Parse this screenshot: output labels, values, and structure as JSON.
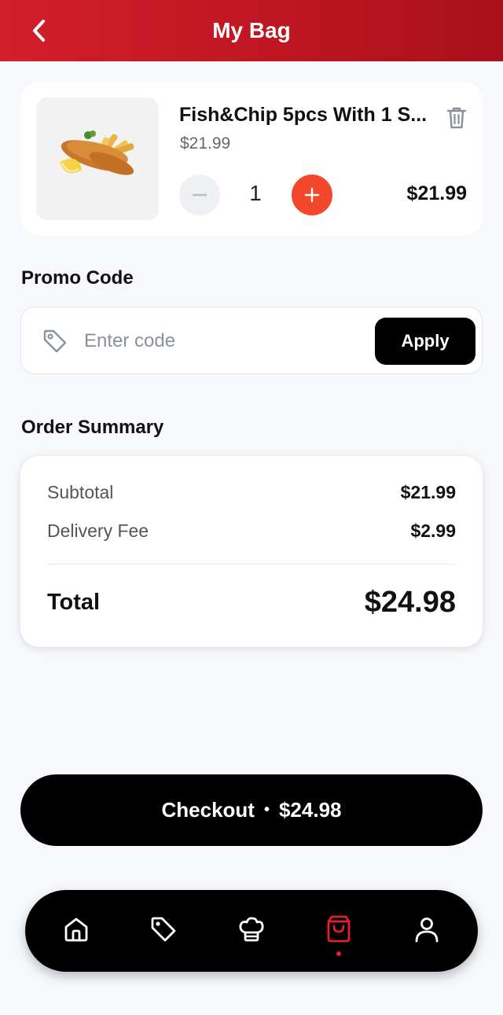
{
  "header": {
    "title": "My Bag",
    "back_icon": "chevron-left-icon"
  },
  "cart": {
    "items": [
      {
        "name": "Fish&Chip 5pcs With 1 S...",
        "unit_price": "$21.99",
        "quantity": "1",
        "line_total": "$21.99",
        "image": "fish-and-chips-photo"
      }
    ]
  },
  "promo": {
    "heading": "Promo Code",
    "placeholder": "Enter code",
    "value": "",
    "apply_label": "Apply",
    "icon": "tag-icon"
  },
  "summary": {
    "heading": "Order Summary",
    "subtotal_label": "Subtotal",
    "subtotal_value": "$21.99",
    "delivery_label": "Delivery Fee",
    "delivery_value": "$2.99",
    "total_label": "Total",
    "total_value": "$24.98"
  },
  "checkout": {
    "label": "Checkout",
    "separator": "•",
    "amount": "$24.98"
  },
  "tabbar": {
    "items": [
      {
        "name": "home",
        "icon": "home-icon",
        "active": false
      },
      {
        "name": "offers",
        "icon": "tag-icon",
        "active": false
      },
      {
        "name": "menu",
        "icon": "chef-hat-icon",
        "active": false
      },
      {
        "name": "bag",
        "icon": "shopping-bag-icon",
        "active": true
      },
      {
        "name": "profile",
        "icon": "user-icon",
        "active": false
      }
    ],
    "active_color": "#e0202c"
  },
  "colors": {
    "header_red": "#c01722",
    "accent_orange": "#f2472a",
    "background": "#f6f8fb",
    "dark": "#000000"
  }
}
